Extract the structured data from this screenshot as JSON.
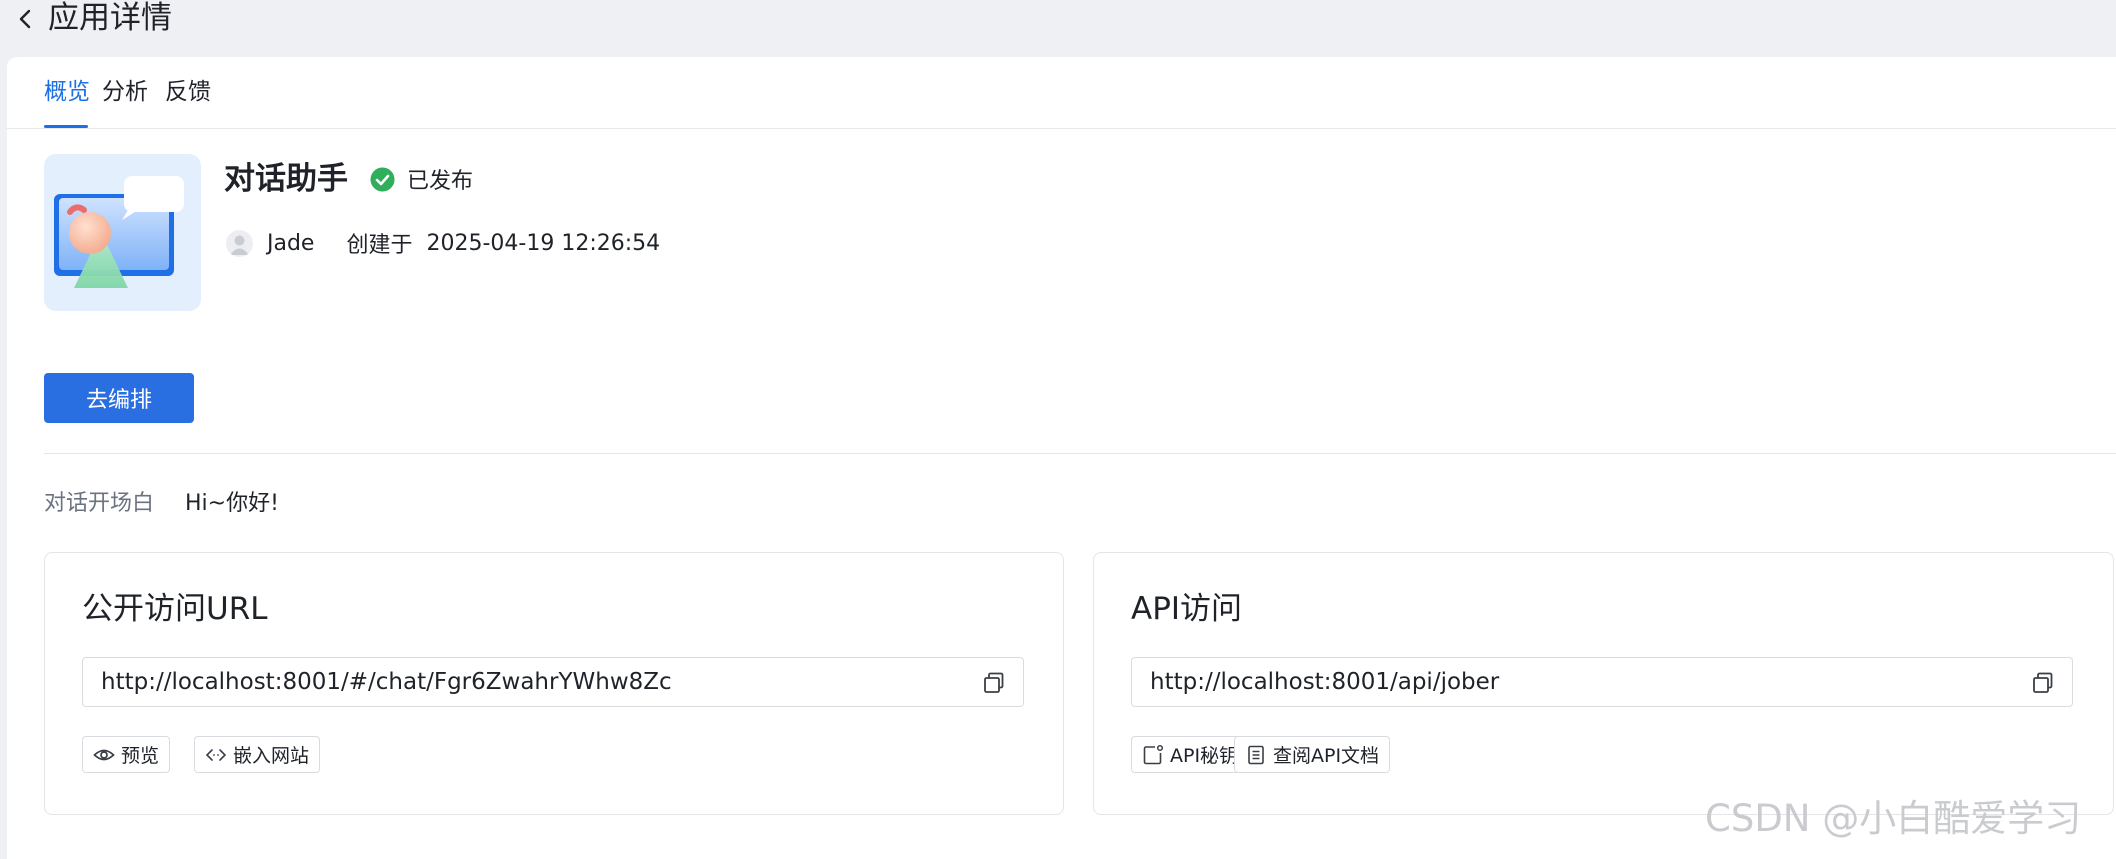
{
  "header": {
    "title": "应用详情"
  },
  "tabs": [
    {
      "label": "概览",
      "active": true
    },
    {
      "label": "分析",
      "active": false
    },
    {
      "label": "反馈",
      "active": false
    }
  ],
  "app": {
    "name": "对话助手",
    "status": "已发布",
    "owner": "Jade",
    "created_label": "创建于",
    "created_at": "2025-04-19 12:26:54"
  },
  "actions": {
    "edit_label": "去编排"
  },
  "opener": {
    "label": "对话开场白",
    "value": "Hi~你好!"
  },
  "public_access": {
    "title": "公开访问URL",
    "url": "http://localhost:8001/#/chat/Fgr6ZwahrYWhw8Zc",
    "preview_label": "预览",
    "embed_label": "嵌入网站"
  },
  "api_access": {
    "title": "API访问",
    "url": "http://localhost:8001/api/jober",
    "key_label": "API秘钥",
    "docs_label": "查阅API文档"
  },
  "watermark": "CSDN @小白酷爱学习",
  "colors": {
    "accent": "#1d6fe6",
    "button": "#2a6fe1",
    "status_green": "#2fae5c",
    "background": "#eef0f4"
  },
  "icons": {
    "back": "chevron-left-icon",
    "status": "check-circle-icon",
    "copy": "copy-icon",
    "preview": "eye-icon",
    "embed": "code-icon",
    "key": "key-icon",
    "docs": "document-icon"
  }
}
